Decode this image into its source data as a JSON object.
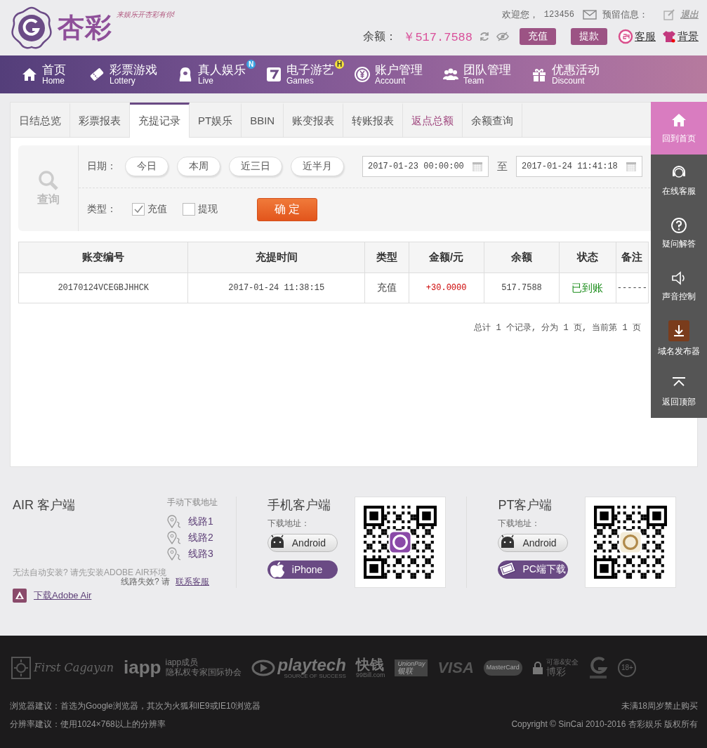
{
  "header": {
    "logo_text": "杏彩",
    "slogan": "来娱乐开杏彩有你!",
    "welcome": "欢迎您，",
    "username": "123456",
    "message_label": "预留信息：",
    "logout": "退出",
    "balance_label": "余额：",
    "balance": "￥517.7588",
    "buttons": [
      "充值",
      "提款"
    ],
    "links": [
      {
        "kind": "service",
        "label": "客服"
      },
      {
        "kind": "theme",
        "label": "背景"
      }
    ]
  },
  "nav": [
    {
      "label": "首页",
      "sub": "Home"
    },
    {
      "label": "彩票游戏",
      "sub": "Lottery"
    },
    {
      "label": "真人娱乐",
      "sub": "Live",
      "badge": "N"
    },
    {
      "label": "电子游艺",
      "sub": "Games",
      "badge": "H"
    },
    {
      "label": "账户管理",
      "sub": "Account"
    },
    {
      "label": "团队管理",
      "sub": "Team"
    },
    {
      "label": "优惠活动",
      "sub": "Discount"
    }
  ],
  "tabs": [
    {
      "label": "日结总览",
      "selected": false,
      "highlighted": false
    },
    {
      "label": "彩票报表",
      "selected": false,
      "highlighted": false
    },
    {
      "label": "充提记录",
      "selected": true,
      "highlighted": false
    },
    {
      "label": "PT娱乐",
      "selected": false,
      "highlighted": false
    },
    {
      "label": "BBIN",
      "selected": false,
      "highlighted": false
    },
    {
      "label": "账变报表",
      "selected": false,
      "highlighted": false
    },
    {
      "label": "转账报表",
      "selected": false,
      "highlighted": false
    },
    {
      "label": "返点总额",
      "selected": false,
      "highlighted": true
    },
    {
      "label": "余额查询",
      "selected": false,
      "highlighted": false
    }
  ],
  "query": {
    "title": "查询",
    "date_label": "日期：",
    "quick_ranges": [
      "今日",
      "本周",
      "近三日",
      "近半月"
    ],
    "start": "2017-01-23 00:00:00",
    "separator": "至",
    "end": "2017-01-24 11:41:18",
    "type_label": "类型：",
    "types": [
      {
        "label": "充值",
        "checked": true
      },
      {
        "label": "提现",
        "checked": false
      }
    ],
    "submit": "确 定"
  },
  "table": {
    "columns": [
      {
        "label": "账变编号",
        "kind": "text"
      },
      {
        "label": "充提时间",
        "kind": "text"
      },
      {
        "label": "类型",
        "kind": "text"
      },
      {
        "label": "金额/元",
        "kind": "amount"
      },
      {
        "label": "余额",
        "kind": "text"
      },
      {
        "label": "状态",
        "kind": "status"
      },
      {
        "label": "备注",
        "kind": "text"
      }
    ],
    "rows": [
      [
        "20170124VCEGBJHHCK",
        "2017-01-24 11:38:15",
        "充值",
        "+30.0000",
        "517.7588",
        "已到账",
        "------"
      ]
    ]
  },
  "pagination": "总计 1 个记录, 分为 1 页, 当前第 1 页",
  "sidebar": [
    {
      "label": "回到首页",
      "selected": true
    },
    {
      "label": "在线客服",
      "selected": false
    },
    {
      "label": "疑问解答",
      "selected": false
    },
    {
      "label": "声音控制",
      "selected": false
    },
    {
      "label": "域名发布器",
      "selected": false
    },
    {
      "label": "返回顶部",
      "selected": false
    }
  ],
  "downloads": {
    "air": {
      "title": "AIR 客户端",
      "manual_label": "手动下载地址",
      "routes": [
        "线路1",
        "线路2",
        "线路3"
      ],
      "note": "无法自动安装? 请先安装ADOBE AIR环境",
      "download_link": "下载Adobe Air",
      "fail_text": "线路失效? 请",
      "contact_link": "联系客服"
    },
    "clients": [
      {
        "title": "手机客户端",
        "address_label": "下载地址：",
        "buttons": [
          {
            "kind": "android",
            "label": "Android",
            "primary": false
          },
          {
            "kind": "apple",
            "label": "iPhone",
            "primary": true
          }
        ]
      },
      {
        "title": "PT客户端",
        "address_label": "下载地址：",
        "buttons": [
          {
            "kind": "android",
            "label": "Android",
            "primary": false
          },
          {
            "kind": "pc",
            "label": "PC端下载",
            "primary": true
          }
        ]
      }
    ]
  },
  "footer": {
    "logos": [
      {
        "kind": "script",
        "lines": [
          "First Cagayan"
        ]
      },
      {
        "kind": "iapp",
        "lines": [
          "iapp",
          "iapp成员",
          "隐私权专家国际协会"
        ]
      },
      {
        "kind": "playtech",
        "lines": [
          "playtech",
          "SOURCE OF SUCCESS"
        ]
      },
      {
        "kind": "kuaiqian",
        "lines": [
          "快钱",
          "99Bill.com"
        ]
      },
      {
        "kind": "card",
        "lines": [
          "UnionPay",
          "银联"
        ]
      },
      {
        "kind": "visa",
        "lines": [
          "VISA"
        ]
      },
      {
        "kind": "mastercard",
        "lines": [
          "MasterCard"
        ]
      },
      {
        "kind": "secure",
        "lines": [
          "可靠&安全",
          "博彩"
        ]
      },
      {
        "kind": "cert"
      },
      {
        "kind": "age",
        "lines": [
          "18+"
        ]
      }
    ],
    "left_notes": [
      "浏览器建议：首选为Google浏览器，其次为火狐和IE9或IE10浏览器",
      "分辨率建议：使用1024×768以上的分辨率"
    ],
    "right_notes": [
      "未满18周岁禁止购买",
      "Copyright © SinCai 2010-2016 杏彩娱乐 版权所有"
    ]
  }
}
